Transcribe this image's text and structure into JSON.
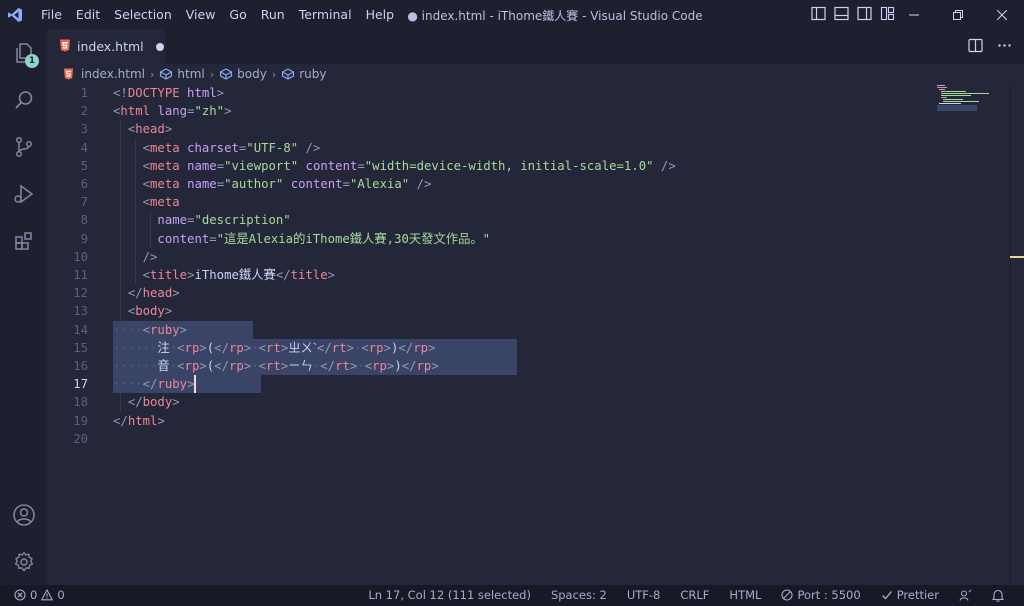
{
  "window": {
    "title": "● index.html - iThome鐵人賽 - Visual Studio Code"
  },
  "menu": [
    "File",
    "Edit",
    "Selection",
    "View",
    "Go",
    "Run",
    "Terminal",
    "Help"
  ],
  "activity": {
    "explorer_badge": "1",
    "icons": [
      "explorer-icon",
      "search-icon",
      "source-control-icon",
      "run-debug-icon",
      "extensions-icon",
      "account-icon",
      "settings-gear-icon"
    ]
  },
  "tab": {
    "label": "index.html",
    "icon": "html5-icon",
    "dirty": true
  },
  "breadcrumb": [
    "index.html",
    "html",
    "body",
    "ruby"
  ],
  "editor": {
    "active_line": 17,
    "lines": [
      {
        "n": "1",
        "tokens": [
          [
            "p",
            "<!"
          ],
          [
            "t",
            "DOCTYPE"
          ],
          [
            "x",
            " "
          ],
          [
            "a",
            "html"
          ],
          [
            "p",
            ">"
          ]
        ]
      },
      {
        "n": "2",
        "tokens": [
          [
            "p",
            "<"
          ],
          [
            "t",
            "html"
          ],
          [
            "x",
            " "
          ],
          [
            "a",
            "lang"
          ],
          [
            "p",
            "="
          ],
          [
            "s",
            "\"zh\""
          ],
          [
            "p",
            ">"
          ]
        ]
      },
      {
        "n": "3",
        "tokens": [
          [
            "x",
            "  "
          ],
          [
            "p",
            "<"
          ],
          [
            "t",
            "head"
          ],
          [
            "p",
            ">"
          ]
        ]
      },
      {
        "n": "4",
        "tokens": [
          [
            "x",
            "    "
          ],
          [
            "p",
            "<"
          ],
          [
            "t",
            "meta"
          ],
          [
            "x",
            " "
          ],
          [
            "a",
            "charset"
          ],
          [
            "p",
            "="
          ],
          [
            "s",
            "\"UTF-8\""
          ],
          [
            "x",
            " "
          ],
          [
            "p",
            "/>"
          ]
        ]
      },
      {
        "n": "5",
        "tokens": [
          [
            "x",
            "    "
          ],
          [
            "p",
            "<"
          ],
          [
            "t",
            "meta"
          ],
          [
            "x",
            " "
          ],
          [
            "a",
            "name"
          ],
          [
            "p",
            "="
          ],
          [
            "s",
            "\"viewport\""
          ],
          [
            "x",
            " "
          ],
          [
            "a",
            "content"
          ],
          [
            "p",
            "="
          ],
          [
            "s",
            "\"width=device-width, initial-scale=1.0\""
          ],
          [
            "x",
            " "
          ],
          [
            "p",
            "/>"
          ]
        ]
      },
      {
        "n": "6",
        "tokens": [
          [
            "x",
            "    "
          ],
          [
            "p",
            "<"
          ],
          [
            "t",
            "meta"
          ],
          [
            "x",
            " "
          ],
          [
            "a",
            "name"
          ],
          [
            "p",
            "="
          ],
          [
            "s",
            "\"author\""
          ],
          [
            "x",
            " "
          ],
          [
            "a",
            "content"
          ],
          [
            "p",
            "="
          ],
          [
            "s",
            "\"Alexia\""
          ],
          [
            "x",
            " "
          ],
          [
            "p",
            "/>"
          ]
        ]
      },
      {
        "n": "7",
        "tokens": [
          [
            "x",
            "    "
          ],
          [
            "p",
            "<"
          ],
          [
            "t",
            "meta"
          ]
        ]
      },
      {
        "n": "8",
        "tokens": [
          [
            "x",
            "      "
          ],
          [
            "a",
            "name"
          ],
          [
            "p",
            "="
          ],
          [
            "s",
            "\"description\""
          ]
        ]
      },
      {
        "n": "9",
        "tokens": [
          [
            "x",
            "      "
          ],
          [
            "a",
            "content"
          ],
          [
            "p",
            "="
          ],
          [
            "s",
            "\"這是Alexia的iThome鐵人賽,30天發文作品。\""
          ]
        ]
      },
      {
        "n": "10",
        "tokens": [
          [
            "x",
            "    "
          ],
          [
            "p",
            "/>"
          ]
        ]
      },
      {
        "n": "11",
        "tokens": [
          [
            "x",
            "    "
          ],
          [
            "p",
            "<"
          ],
          [
            "t",
            "title"
          ],
          [
            "p",
            ">"
          ],
          [
            "x",
            "iThome鐵人賽"
          ],
          [
            "p",
            "</"
          ],
          [
            "t",
            "title"
          ],
          [
            "p",
            ">"
          ]
        ]
      },
      {
        "n": "12",
        "tokens": [
          [
            "x",
            "  "
          ],
          [
            "p",
            "</"
          ],
          [
            "t",
            "head"
          ],
          [
            "p",
            ">"
          ]
        ]
      },
      {
        "n": "13",
        "tokens": [
          [
            "x",
            "  "
          ],
          [
            "p",
            "<"
          ],
          [
            "t",
            "body"
          ],
          [
            "p",
            ">"
          ]
        ]
      },
      {
        "n": "14",
        "tokens": [
          [
            "w",
            "····"
          ],
          [
            "p",
            "<"
          ],
          [
            "t",
            "ruby"
          ],
          [
            "p",
            ">"
          ]
        ]
      },
      {
        "n": "15",
        "tokens": [
          [
            "w",
            "······"
          ],
          [
            "x",
            "注"
          ],
          [
            "w",
            "·"
          ],
          [
            "p",
            "<"
          ],
          [
            "t",
            "rp"
          ],
          [
            "p",
            ">"
          ],
          [
            "x",
            "("
          ],
          [
            "p",
            "</"
          ],
          [
            "t",
            "rp"
          ],
          [
            "p",
            ">"
          ],
          [
            "w",
            "·"
          ],
          [
            "p",
            "<"
          ],
          [
            "t",
            "rt"
          ],
          [
            "p",
            ">"
          ],
          [
            "x",
            "ㄓㄨˋ"
          ],
          [
            "p",
            "</"
          ],
          [
            "t",
            "rt"
          ],
          [
            "p",
            ">"
          ],
          [
            "w",
            "·"
          ],
          [
            "p",
            "<"
          ],
          [
            "t",
            "rp"
          ],
          [
            "p",
            ">"
          ],
          [
            "x",
            ")"
          ],
          [
            "p",
            "</"
          ],
          [
            "t",
            "rp"
          ],
          [
            "p",
            ">"
          ]
        ]
      },
      {
        "n": "16",
        "tokens": [
          [
            "w",
            "······"
          ],
          [
            "x",
            "音"
          ],
          [
            "w",
            "·"
          ],
          [
            "p",
            "<"
          ],
          [
            "t",
            "rp"
          ],
          [
            "p",
            ">"
          ],
          [
            "x",
            "("
          ],
          [
            "p",
            "</"
          ],
          [
            "t",
            "rp"
          ],
          [
            "p",
            ">"
          ],
          [
            "w",
            "·"
          ],
          [
            "p",
            "<"
          ],
          [
            "t",
            "rt"
          ],
          [
            "p",
            ">"
          ],
          [
            "x",
            "ㄧㄣ"
          ],
          [
            "w",
            "·"
          ],
          [
            "p",
            "</"
          ],
          [
            "t",
            "rt"
          ],
          [
            "p",
            ">"
          ],
          [
            "w",
            "·"
          ],
          [
            "p",
            "<"
          ],
          [
            "t",
            "rp"
          ],
          [
            "p",
            ">"
          ],
          [
            "x",
            ")"
          ],
          [
            "p",
            "</"
          ],
          [
            "t",
            "rp"
          ],
          [
            "p",
            ">"
          ]
        ]
      },
      {
        "n": "17",
        "tokens": [
          [
            "w",
            "····"
          ],
          [
            "p",
            "</"
          ],
          [
            "t",
            "ruby"
          ],
          [
            "p",
            ">"
          ]
        ]
      },
      {
        "n": "18",
        "tokens": [
          [
            "x",
            "  "
          ],
          [
            "p",
            "</"
          ],
          [
            "t",
            "body"
          ],
          [
            "p",
            ">"
          ]
        ]
      },
      {
        "n": "19",
        "tokens": [
          [
            "p",
            "</"
          ],
          [
            "t",
            "html"
          ],
          [
            "p",
            ">"
          ]
        ]
      },
      {
        "n": "20",
        "tokens": []
      }
    ]
  },
  "status": {
    "errors": "0",
    "warnings": "0",
    "position": "Ln 17, Col 12 (111 selected)",
    "spaces": "Spaces: 2",
    "encoding": "UTF-8",
    "eol": "CRLF",
    "language": "HTML",
    "port": "Port : 5500",
    "prettier": "Prettier"
  },
  "colors": {
    "background": "#24273a",
    "sidebar": "#1e2030",
    "selection": "#3a4466",
    "tag": "#ed8796",
    "attribute": "#c6a0f6",
    "string": "#a6da95",
    "badge": "#8bd5ca"
  }
}
